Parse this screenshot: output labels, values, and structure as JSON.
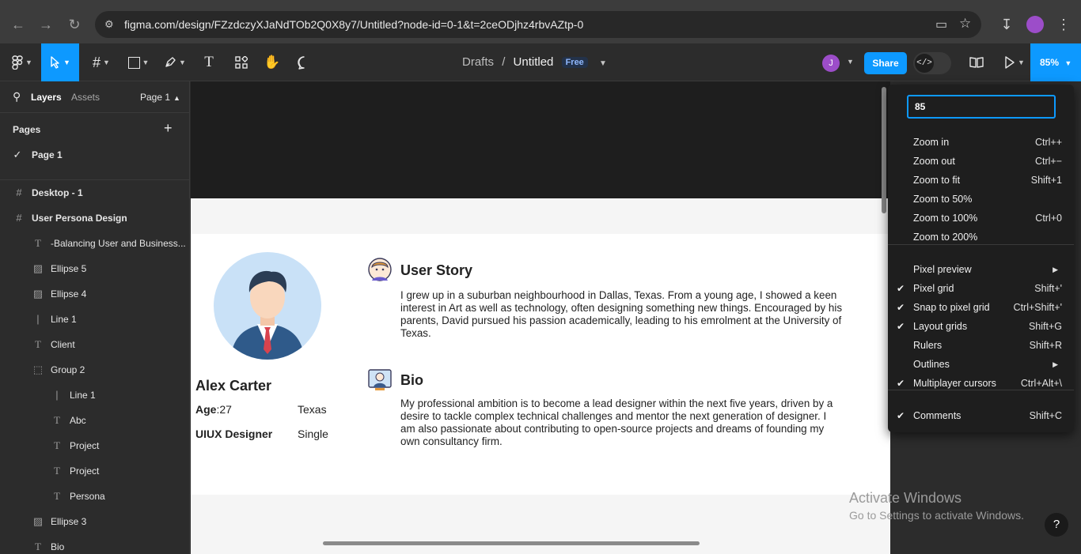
{
  "browser": {
    "url": "figma.com/design/FZzdczyXJaNdTOb2Q0X8y7/Untitled?node-id=0-1&t=2ceODjhz4rbvAZtp-0"
  },
  "toolbar": {
    "breadcrumb_drafts": "Drafts",
    "breadcrumb_sep": "/",
    "file_name": "Untitled",
    "plan_badge": "Free",
    "avatar_initial": "J",
    "share_label": "Share",
    "zoom_label": "85%"
  },
  "left_panel": {
    "tab_layers": "Layers",
    "tab_assets": "Assets",
    "page_selector": "Page 1",
    "pages_header": "Pages",
    "pages": [
      "Page 1"
    ],
    "layers": [
      {
        "name": "Desktop - 1",
        "icon": "frame-icon"
      },
      {
        "name": "User Persona Design",
        "icon": "frame-icon"
      },
      {
        "name": "-Balancing User and Business...",
        "icon": "text-icon"
      },
      {
        "name": "Ellipse 5",
        "icon": "image-icon"
      },
      {
        "name": "Ellipse 4",
        "icon": "image-icon"
      },
      {
        "name": "Line 1",
        "icon": "line-icon"
      },
      {
        "name": "Client",
        "icon": "text-icon"
      },
      {
        "name": "Group 2",
        "icon": "group-icon"
      },
      {
        "name": "Line 1",
        "icon": "line-icon"
      },
      {
        "name": "Abc",
        "icon": "text-icon"
      },
      {
        "name": "Project",
        "icon": "text-icon"
      },
      {
        "name": "Project",
        "icon": "text-icon"
      },
      {
        "name": "Persona",
        "icon": "text-icon"
      },
      {
        "name": "Ellipse 3",
        "icon": "image-icon"
      },
      {
        "name": "Bio",
        "icon": "text-icon"
      }
    ]
  },
  "persona": {
    "name": "Alex  Carter",
    "age_label": "Age",
    "age_value": ":27",
    "location": "Texas",
    "role": "UIUX Designer",
    "status": "Single",
    "story_title": "User Story",
    "story_lines": [
      "I grew up in a suburban neighbourhood in Dallas, Texas. From a young age, I showed a keen",
      "interest in Art as well as technology, often designing something new things. Encouraged by his",
      "parents, David pursued his passion academically, leading to his emrolment at the University of",
      "Texas."
    ],
    "bio_title": "Bio",
    "bio_lines": [
      "My professional ambition is to become a lead designer within the next five years, driven by a",
      "desire to tackle complex technical challenges and mentor the next generation of designer. I",
      "am also passionate about contributing to open-source projects and dreams of founding my",
      "own consultancy firm."
    ]
  },
  "zoom_menu": {
    "input_value": "85",
    "items": [
      {
        "label": "Zoom in",
        "shortcut": "Ctrl++",
        "checked": false
      },
      {
        "label": "Zoom out",
        "shortcut": "Ctrl+−",
        "checked": false
      },
      {
        "label": "Zoom to fit",
        "shortcut": "Shift+1",
        "checked": false
      },
      {
        "label": "Zoom to 50%",
        "shortcut": "",
        "checked": false
      },
      {
        "label": "Zoom to 100%",
        "shortcut": "Ctrl+0",
        "checked": false
      },
      {
        "label": "Zoom to 200%",
        "shortcut": "",
        "checked": false
      },
      {
        "label": "Pixel preview",
        "shortcut": "▶",
        "checked": false
      },
      {
        "label": "Pixel grid",
        "shortcut": "Shift+'",
        "checked": true
      },
      {
        "label": "Snap to pixel grid",
        "shortcut": "Ctrl+Shift+'",
        "checked": true
      },
      {
        "label": "Layout grids",
        "shortcut": "Shift+G",
        "checked": true
      },
      {
        "label": "Rulers",
        "shortcut": "Shift+R",
        "checked": false
      },
      {
        "label": "Outlines",
        "shortcut": "▶",
        "checked": false
      },
      {
        "label": "Multiplayer cursors",
        "shortcut": "Ctrl+Alt+\\",
        "checked": true
      },
      {
        "label": "Comments",
        "shortcut": "Shift+C",
        "checked": true
      }
    ],
    "check_glyph": "✔"
  },
  "watermark": {
    "line1": "Activate Windows",
    "line2": "Go to Settings to activate Windows."
  },
  "help_label": "?",
  "colors": {
    "accent": "#0d99ff",
    "panel_bg": "#2c2c2c",
    "canvas_bg": "#1e1e1e"
  }
}
